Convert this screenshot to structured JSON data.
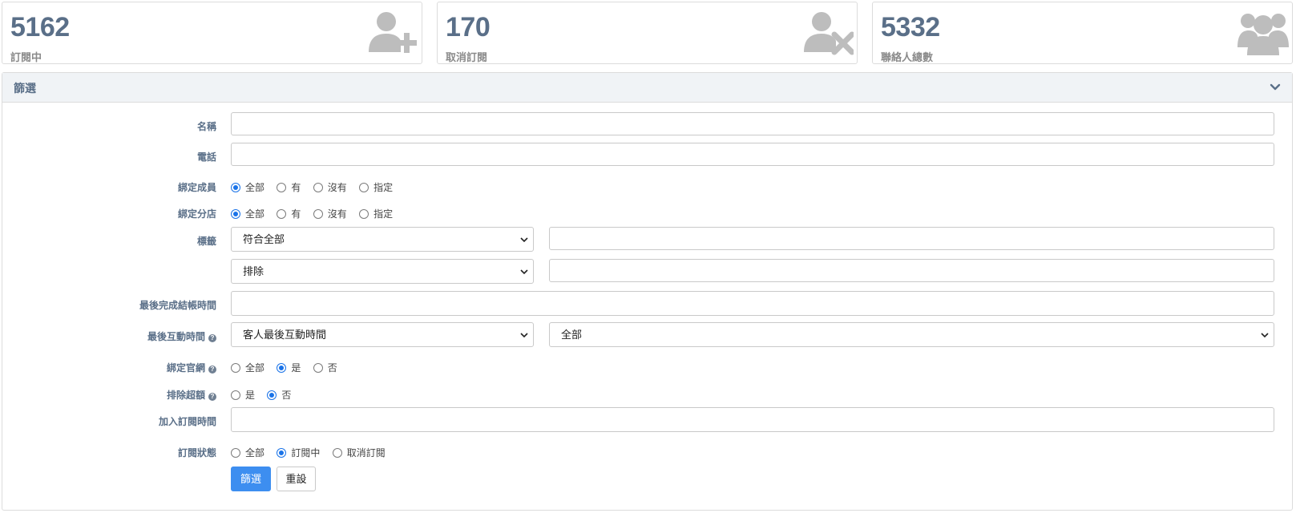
{
  "stats": [
    {
      "value": "5162",
      "label": "訂閱中",
      "icon": "user-plus-icon"
    },
    {
      "value": "170",
      "label": "取消訂閱",
      "icon": "user-times-icon"
    },
    {
      "value": "5332",
      "label": "聯絡人總數",
      "icon": "users-icon"
    }
  ],
  "filter": {
    "title": "篩選",
    "name_label": "名稱",
    "name_value": "",
    "phone_label": "電話",
    "phone_value": "",
    "bind_member": {
      "label": "綁定成員",
      "options": [
        "全部",
        "有",
        "沒有",
        "指定"
      ],
      "selected": "全部"
    },
    "bind_branch": {
      "label": "綁定分店",
      "options": [
        "全部",
        "有",
        "沒有",
        "指定"
      ],
      "selected": "全部"
    },
    "tags": {
      "label": "標籤",
      "match_select": "符合全部",
      "match_input": "",
      "exclude_select": "排除",
      "exclude_input": ""
    },
    "last_checkout_label": "最後完成結帳時間",
    "last_checkout_value": "",
    "last_interaction": {
      "label": "最後互動時間",
      "type_select": "客人最後互動時間",
      "range_select": "全部"
    },
    "bind_website": {
      "label": "綁定官網",
      "options": [
        "全部",
        "是",
        "否"
      ],
      "selected": "是"
    },
    "exclude_overquota": {
      "label": "排除超額",
      "options": [
        "是",
        "否"
      ],
      "selected": "否"
    },
    "subscribe_time_label": "加入訂閱時間",
    "subscribe_time_value": "",
    "subscribe_status": {
      "label": "訂閱狀態",
      "options": [
        "全部",
        "訂閱中",
        "取消訂閱"
      ],
      "selected": "訂閱中"
    },
    "submit_label": "篩選",
    "reset_label": "重設"
  },
  "colors": {
    "accent": "#3d8ef0",
    "label_text": "#5a6f88",
    "radio_checked": "#1a73e8",
    "icon_gray": "#bdbdbd",
    "header_bg": "#f0f3f6"
  }
}
